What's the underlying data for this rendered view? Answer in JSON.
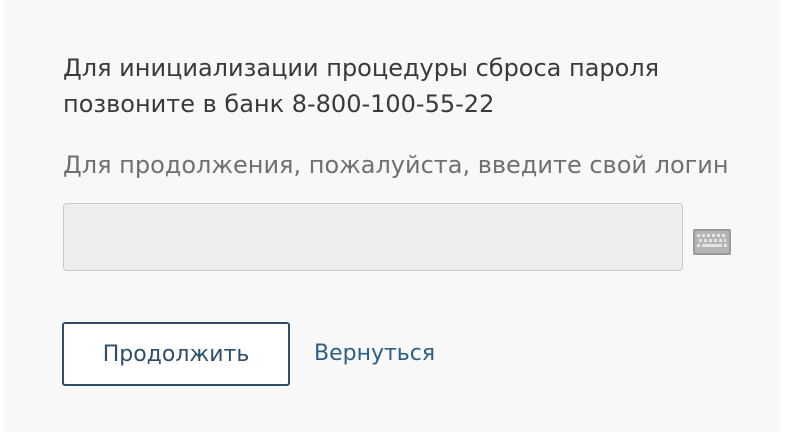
{
  "instructions": {
    "line1": "Для инициализации процедуры сброса пароля",
    "line2": "позвоните в банк 8-800-100-55-22"
  },
  "login": {
    "prompt": "Для продолжения, пожалуйста, введите свой логин",
    "value": "",
    "placeholder": ""
  },
  "keyboard": {
    "icon": "keyboard-icon"
  },
  "actions": {
    "continue_label": "Продолжить",
    "back_label": "Вернуться"
  },
  "colors": {
    "accent": "#2d4f6b",
    "link": "#2d5f86",
    "input_bg": "#eeeeee"
  }
}
